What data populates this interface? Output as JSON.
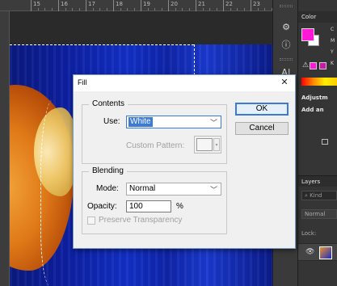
{
  "ruler": {
    "numbers": [
      "15",
      "16",
      "17",
      "18",
      "19",
      "20",
      "21",
      "22",
      "23"
    ]
  },
  "panels": {
    "color_tab": "Color",
    "color_labels": [
      "C",
      "M",
      "Y",
      "K"
    ],
    "adjustments_tab": "Adjustm",
    "adjustments_sub": "Add an",
    "layers_tab": "Layers",
    "kind_placeholder": "Kind",
    "blend_mode": "Normal",
    "lock_label": "Lock:",
    "fg_color": "#ff19d6",
    "bg_color": "#ffffff"
  },
  "dialog": {
    "title": "Fill",
    "close_glyph": "✕",
    "contents_legend": "Contents",
    "use_label": "Use:",
    "use_value": "White",
    "custom_pattern_label": "Custom Pattern:",
    "blending_legend": "Blending",
    "mode_label": "Mode:",
    "mode_value": "Normal",
    "opacity_label": "Opacity:",
    "opacity_value": "100",
    "opacity_unit": "%",
    "preserve_label": "Preserve Transparency",
    "ok_label": "OK",
    "cancel_label": "Cancel"
  }
}
